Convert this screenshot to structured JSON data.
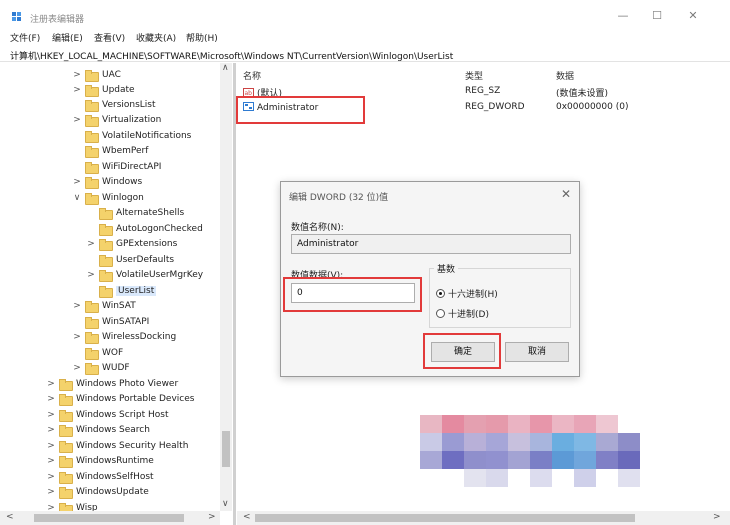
{
  "window": {
    "title": "注册表编辑器",
    "minimize_glyph": "—",
    "maximize_glyph": "☐",
    "close_glyph": "✕"
  },
  "menu": [
    "文件(F)",
    "编辑(E)",
    "查看(V)",
    "收藏夹(A)",
    "帮助(H)"
  ],
  "address": "计算机\\HKEY_LOCAL_MACHINE\\SOFTWARE\\Microsoft\\Windows NT\\CurrentVersion\\Winlogon\\UserList",
  "tree": {
    "items": [
      {
        "label": "UAC",
        "chevron": ">"
      },
      {
        "label": "Update",
        "chevron": ">"
      },
      {
        "label": "VersionsList",
        "chevron": ""
      },
      {
        "label": "Virtualization",
        "chevron": ">"
      },
      {
        "label": "VolatileNotifications",
        "chevron": ""
      },
      {
        "label": "WbemPerf",
        "chevron": ""
      },
      {
        "label": "WiFiDirectAPI",
        "chevron": ""
      },
      {
        "label": "Windows",
        "chevron": ">"
      },
      {
        "label": "Winlogon",
        "chevron": "∨"
      },
      {
        "label": "AlternateShells",
        "chevron": ""
      },
      {
        "label": "AutoLogonChecked",
        "chevron": ""
      },
      {
        "label": "GPExtensions",
        "chevron": ">"
      },
      {
        "label": "UserDefaults",
        "chevron": ""
      },
      {
        "label": "VolatileUserMgrKey",
        "chevron": ">"
      },
      {
        "label": "UserList",
        "chevron": ""
      },
      {
        "label": "WinSAT",
        "chevron": ">"
      },
      {
        "label": "WinSATAPI",
        "chevron": ""
      },
      {
        "label": "WirelessDocking",
        "chevron": ">"
      },
      {
        "label": "WOF",
        "chevron": ""
      },
      {
        "label": "WUDF",
        "chevron": ">"
      },
      {
        "label": "Windows Photo Viewer",
        "chevron": ">"
      },
      {
        "label": "Windows Portable Devices",
        "chevron": ">"
      },
      {
        "label": "Windows Script Host",
        "chevron": ">"
      },
      {
        "label": "Windows Search",
        "chevron": ">"
      },
      {
        "label": "Windows Security Health",
        "chevron": ">"
      },
      {
        "label": "WindowsRuntime",
        "chevron": ">"
      },
      {
        "label": "WindowsSelfHost",
        "chevron": ">"
      },
      {
        "label": "WindowsUpdate",
        "chevron": ">"
      },
      {
        "label": "Wisp",
        "chevron": ">"
      }
    ]
  },
  "list": {
    "headers": {
      "name": "名称",
      "type": "类型",
      "data": "数据"
    },
    "rows": [
      {
        "name": "(默认)",
        "type": "REG_SZ",
        "data": "(数值未设置)"
      },
      {
        "name": "Administrator",
        "type": "REG_DWORD",
        "data": "0x00000000 (0)"
      }
    ]
  },
  "dialog": {
    "title": "编辑 DWORD (32 位)值",
    "close": "✕",
    "name_label": "数值名称(N):",
    "name_value": "Administrator",
    "data_label": "数值数据(V):",
    "data_value": "0",
    "base_label": "基数",
    "radio_hex": "十六进制(H)",
    "radio_dec": "十进制(D)",
    "selected_base": "hex",
    "ok": "确定",
    "cancel": "取消"
  },
  "scroll": {
    "left_arrow": "<",
    "right_arrow": ">",
    "down_arrow": "∨",
    "up_arrow": "∧"
  },
  "colors": {
    "highlight": "#e23a3a",
    "selection": "#d9e8fb",
    "folder": "#f4d26b"
  }
}
